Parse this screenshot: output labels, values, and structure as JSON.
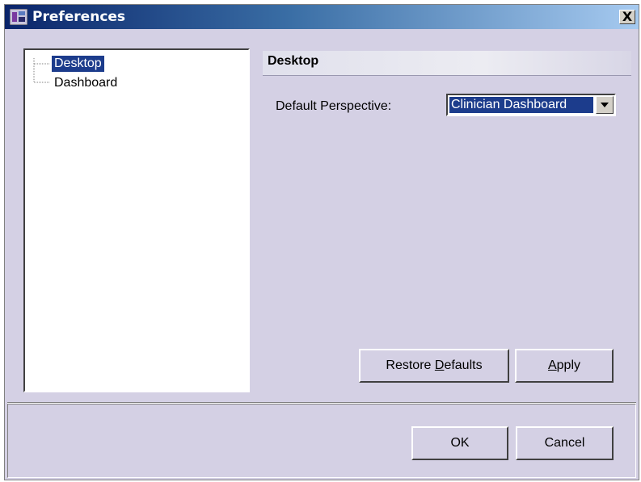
{
  "window": {
    "title": "Preferences",
    "close_label": "X"
  },
  "tree": {
    "items": [
      {
        "label": "Desktop",
        "selected": true
      },
      {
        "label": "Dashboard",
        "selected": false
      }
    ]
  },
  "panel": {
    "header": "Desktop",
    "perspective_label": "Default Perspective:",
    "perspective_value": "Clinician Dashboard"
  },
  "buttons": {
    "restore_pre": "Restore ",
    "restore_mnemonic": "D",
    "restore_post": "efaults",
    "apply_mnemonic": "A",
    "apply_post": "pply",
    "ok": "OK",
    "cancel": "Cancel"
  },
  "colors": {
    "selection": "#1c3c8c",
    "titlebar_start": "#0a246a",
    "window_bg": "#d4d0e4"
  }
}
